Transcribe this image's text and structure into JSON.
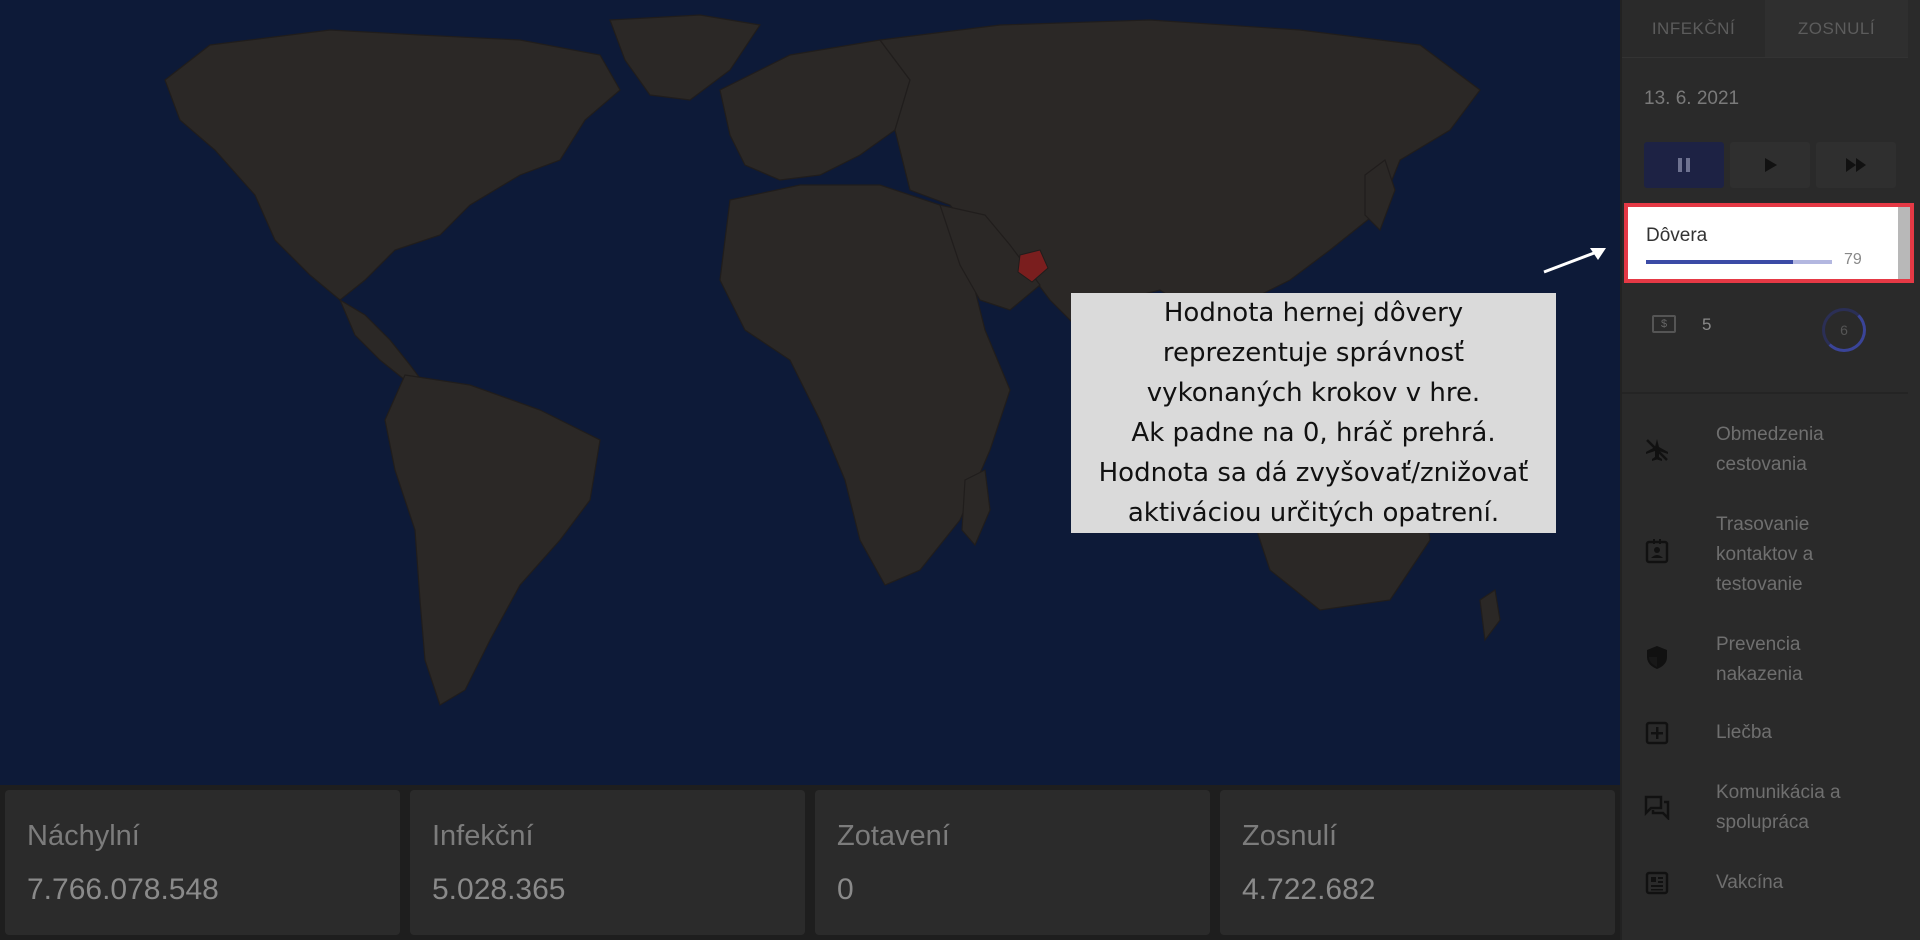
{
  "stats": [
    {
      "label": "Náchylní",
      "value": "7.766.078.548"
    },
    {
      "label": "Infekční",
      "value": "5.028.365"
    },
    {
      "label": "Zotavení",
      "value": "0"
    },
    {
      "label": "Zosnulí",
      "value": "4.722.682"
    }
  ],
  "sidebar": {
    "tabs": [
      "INFEKČNÍ",
      "ZOSNULÍ"
    ],
    "date": "13. 6. 2021",
    "controls": [
      {
        "icon": "pause-icon",
        "active": true
      },
      {
        "icon": "play-icon",
        "active": false
      },
      {
        "icon": "fast-forward-icon",
        "active": false
      }
    ],
    "trust": {
      "label": "Dôvera",
      "value": "79",
      "fraction": 0.79
    },
    "money": {
      "icon": "money-icon",
      "value": "5"
    },
    "points": {
      "value": "6"
    },
    "measures": [
      {
        "icon": "plane-off-icon",
        "label": "Obmedzenia cestovania"
      },
      {
        "icon": "contact-badge-icon",
        "label": "Trasovanie kontaktov a testovanie"
      },
      {
        "icon": "shield-icon",
        "label": "Prevencia nakazenia"
      },
      {
        "icon": "medical-plus-icon",
        "label": "Liečba"
      },
      {
        "icon": "chat-icon",
        "label": "Komunikácia a spolupráca"
      },
      {
        "icon": "vaccine-icon",
        "label": "Vakcína"
      }
    ]
  },
  "tutorial": {
    "lines": [
      "Hodnota hernej dôvery",
      "reprezentuje správnosť",
      "vykonaných krokov v hre.",
      "Ak padne na 0, hráč prehrá.",
      "Hodnota sa dá zvyšovať/znižovať",
      "aktiváciou určitých opatrení."
    ]
  },
  "colors": {
    "ocean": "#0d1a38",
    "land": "#2b2826",
    "infected_region": "#7a1e1e",
    "trust_bar": "#3b4ba6",
    "highlight_border": "#e53945"
  }
}
